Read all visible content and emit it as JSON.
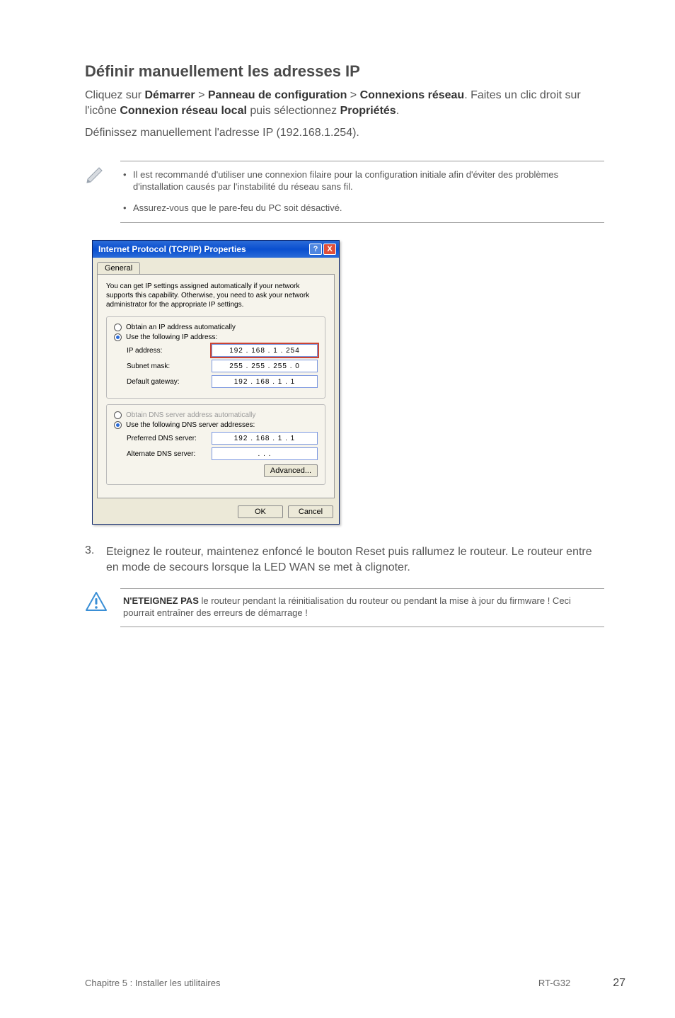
{
  "heading": "Définir manuellement les adresses IP",
  "para1_a": "Cliquez sur ",
  "para1_b": "Démarrer",
  "para1_c": " > ",
  "para1_d": "Panneau de configuration",
  "para1_e": " > ",
  "para1_f": "Connexions réseau",
  "para1_g": ". Faites un clic droit sur l'icône ",
  "para1_h": "Connexion réseau local",
  "para1_i": " puis sélectionnez ",
  "para1_j": "Propriétés",
  "para1_k": ".",
  "para2": "Définissez manuellement l'adresse IP (192.168.1.254).",
  "note_items": [
    "Il est recommandé d'utiliser une connexion filaire pour la configuration initiale afin d'éviter des problèmes d'installation causés par l'instabilité du réseau sans fil.",
    "Assurez-vous que le pare-feu du PC soit désactivé."
  ],
  "dialog": {
    "title": "Internet Protocol (TCP/IP) Properties",
    "help": "?",
    "close": "X",
    "tab": "General",
    "explain": "You can get IP settings assigned automatically if your network supports this capability. Otherwise, you need to ask your network administrator for the appropriate IP settings.",
    "r_obtain_ip": "Obtain an IP address automatically",
    "r_use_ip": "Use the following IP address:",
    "lbl_ip": "IP address:",
    "val_ip": "192 . 168 .  1  . 254",
    "lbl_mask": "Subnet mask:",
    "val_mask": "255 . 255 . 255 .  0",
    "lbl_gw": "Default gateway:",
    "val_gw": "192 . 168 .  1  .  1",
    "r_obtain_dns": "Obtain DNS server address automatically",
    "r_use_dns": "Use the following DNS server addresses:",
    "lbl_pdns": "Preferred DNS server:",
    "val_pdns": "192 . 168 .  1  .  1",
    "lbl_adns": "Alternate DNS server:",
    "val_adns": " .    .    . ",
    "advanced": "Advanced...",
    "ok": "OK",
    "cancel": "Cancel"
  },
  "step3_num": "3.",
  "step3_text": "Eteignez le routeur, maintenez enfoncé le bouton Reset puis rallumez le routeur. Le routeur entre en mode de secours lorsque la LED WAN se met à clignoter.",
  "warn_bold": "N'ETEIGNEZ PAS",
  "warn_rest": " le routeur pendant la réinitialisation du routeur ou pendant la mise à jour du firmware ! Ceci pourrait entraîner des erreurs de démarrage !",
  "footer_left": "Chapitre 5 : Installer les utilitaires",
  "footer_model": "RT-G32",
  "footer_page": "27"
}
